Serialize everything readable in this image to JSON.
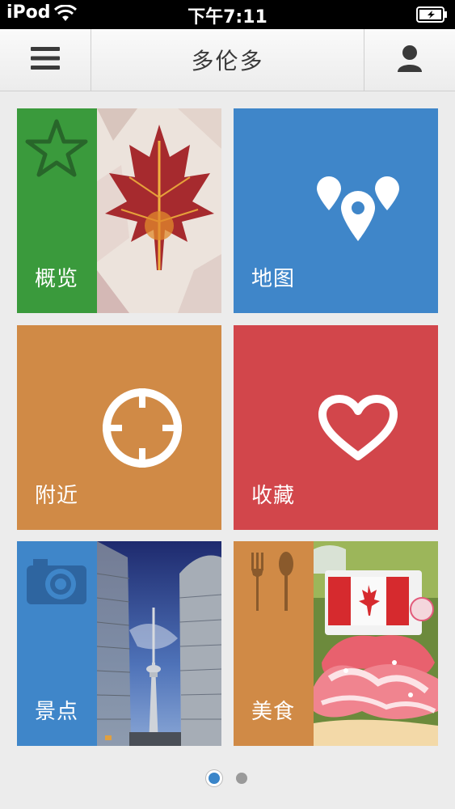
{
  "status_bar": {
    "carrier": "iPod",
    "time": "下午7:11"
  },
  "nav": {
    "title": "多伦多",
    "menu_icon": "menu-icon",
    "profile_icon": "user-icon"
  },
  "tiles": [
    {
      "label": "概览",
      "icon": "star-icon",
      "color": "#3a9a3c"
    },
    {
      "label": "地图",
      "icon": "map-pins-icon",
      "color": "#3f86c9"
    },
    {
      "label": "附近",
      "icon": "crosshair-icon",
      "color": "#d08a46"
    },
    {
      "label": "收藏",
      "icon": "heart-icon",
      "color": "#d2464b"
    },
    {
      "label": "景点",
      "icon": "camera-icon",
      "color": "#3f86c9"
    },
    {
      "label": "美食",
      "icon": "fork-spoon-icon",
      "color": "#d08a46"
    }
  ],
  "pager": {
    "pages": 2,
    "current": 1
  }
}
